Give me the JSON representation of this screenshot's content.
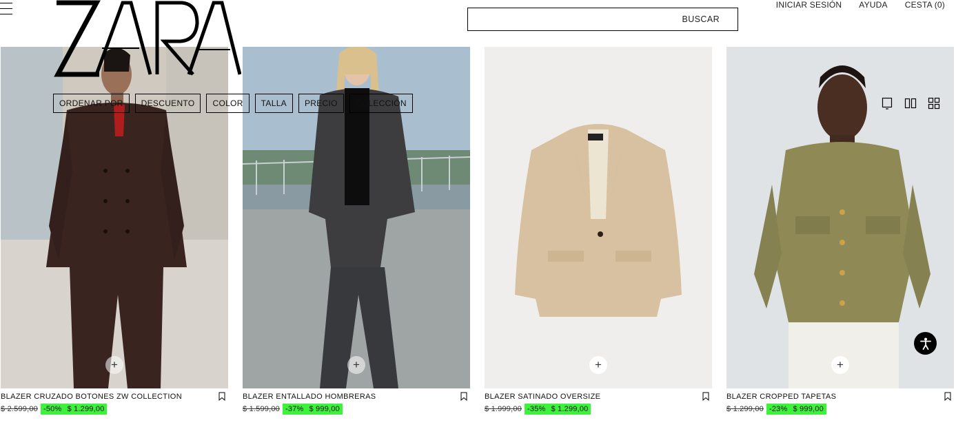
{
  "header": {
    "logo_text": "ZARA",
    "search_label": "BUSCAR",
    "links": [
      "INICIAR SESIÓN",
      "AYUDA",
      "CESTA (0)"
    ]
  },
  "filters": [
    "ORDENAR POR",
    "DESCUENTO",
    "COLOR",
    "TALLA",
    "PRECIO",
    "COLECCIÓN"
  ],
  "view_icons": [
    "single-column-view-icon",
    "two-column-view-icon",
    "grid-view-icon"
  ],
  "products": [
    {
      "name": "BLAZER CRUZADO BOTONES ZW COLLECTION",
      "old_price": "$ 2.599,00",
      "discount": "-50%",
      "price": "$ 1.299,00"
    },
    {
      "name": "BLAZER ENTALLADO HOMBRERAS",
      "old_price": "$ 1.599,00",
      "discount": "-37%",
      "price": "$ 999,00"
    },
    {
      "name": "BLAZER SATINADO OVERSIZE",
      "old_price": "$ 1.999,00",
      "discount": "-35%",
      "price": "$ 1.299,00"
    },
    {
      "name": "BLAZER CROPPED TAPETAS",
      "old_price": "$ 1.299,00",
      "discount": "-23%",
      "price": "$ 999,00"
    }
  ],
  "add_symbol": "+",
  "colors": {
    "discount_highlight": "#3df23a",
    "accessibility_button": "#000000"
  }
}
